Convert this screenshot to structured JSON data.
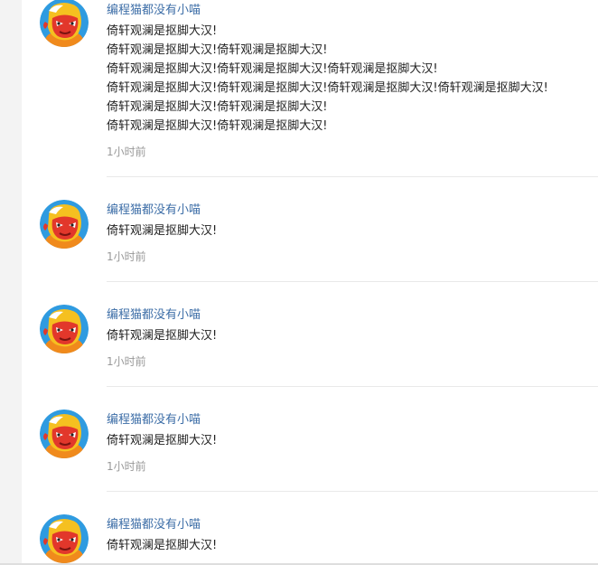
{
  "comments": [
    {
      "username": "编程猫都没有小喵",
      "lines": [
        "倚轩观澜是抠脚大汉!",
        "倚轩观澜是抠脚大汉!倚轩观澜是抠脚大汉!",
        "倚轩观澜是抠脚大汉!倚轩观澜是抠脚大汉!倚轩观澜是抠脚大汉!",
        "倚轩观澜是抠脚大汉!倚轩观澜是抠脚大汉!倚轩观澜是抠脚大汉!倚轩观澜是抠脚大汉!",
        "倚轩观澜是抠脚大汉!倚轩观澜是抠脚大汉!",
        "倚轩观澜是抠脚大汉!倚轩观澜是抠脚大汉!"
      ],
      "time": "1小时前",
      "avatar_icon": "codemao-cat-avatar-icon"
    },
    {
      "username": "编程猫都没有小喵",
      "lines": [
        "倚轩观澜是抠脚大汉!"
      ],
      "time": "1小时前",
      "avatar_icon": "codemao-cat-avatar-icon"
    },
    {
      "username": "编程猫都没有小喵",
      "lines": [
        "倚轩观澜是抠脚大汉!"
      ],
      "time": "1小时前",
      "avatar_icon": "codemao-cat-avatar-icon"
    },
    {
      "username": "编程猫都没有小喵",
      "lines": [
        "倚轩观澜是抠脚大汉!"
      ],
      "time": "1小时前",
      "avatar_icon": "codemao-cat-avatar-icon"
    },
    {
      "username": "编程猫都没有小喵",
      "lines": [
        "倚轩观澜是抠脚大汉!"
      ],
      "time": "",
      "avatar_icon": "codemao-cat-avatar-icon"
    }
  ],
  "colors": {
    "username": "#3d6ea7",
    "text": "#222222",
    "time": "#999999",
    "avatar_bg": "#2f9be0",
    "avatar_face": "#f5c020",
    "avatar_mask": "#e2372b"
  }
}
